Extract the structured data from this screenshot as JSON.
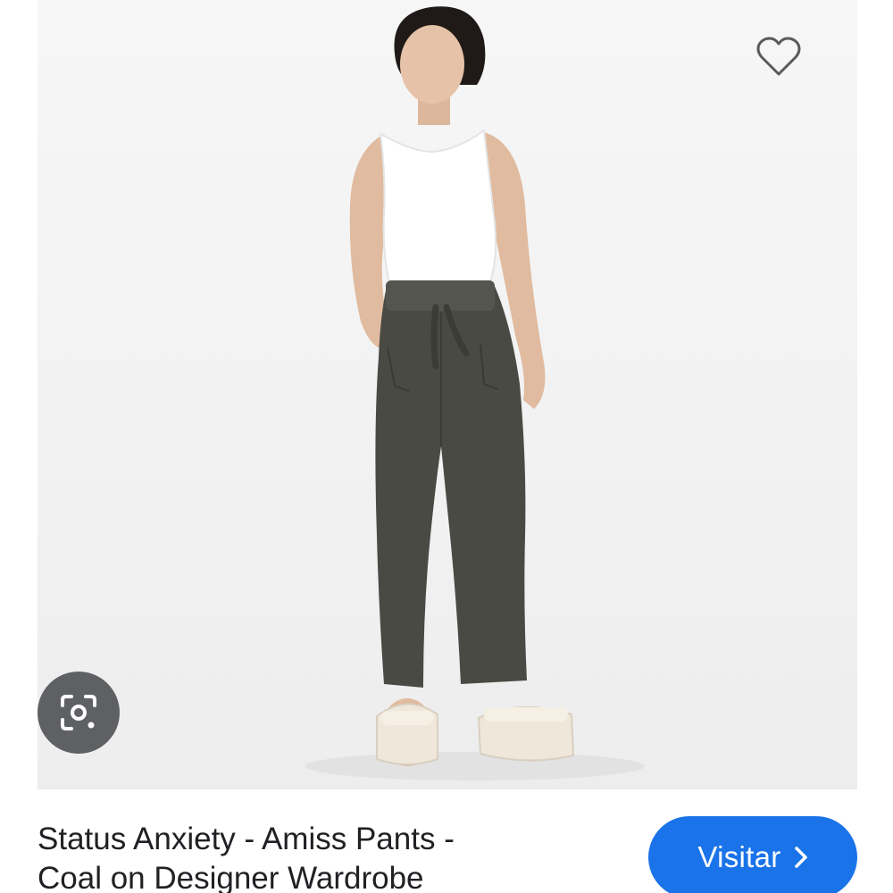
{
  "result": {
    "title": "Status Anxiety - Amiss Pants -\nCoal on Designer Wardrobe",
    "visit_label": "Visitar"
  },
  "icons": {
    "favorite": "heart-outline-icon",
    "lens": "google-lens-icon",
    "visit_arrow": "chevron-right-icon"
  },
  "colors": {
    "accent": "#1a73e8",
    "text": "#202124",
    "lens_bg": "#5f6063",
    "pants": "#4a4a44"
  }
}
